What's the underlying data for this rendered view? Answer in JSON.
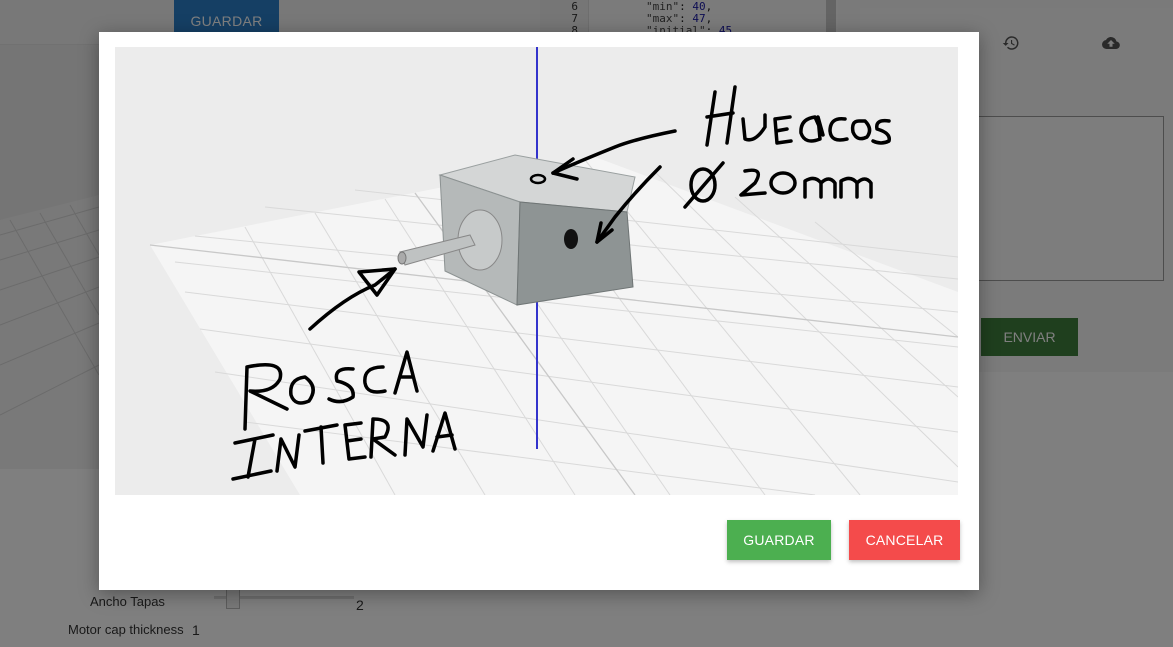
{
  "toolbar": {
    "save_label": "GUARDAR"
  },
  "editor": {
    "lines": [
      {
        "number": "6",
        "key": "\"min\"",
        "value": "40"
      },
      {
        "number": "7",
        "key": "\"max\"",
        "value": "47"
      },
      {
        "number": "8",
        "key": "\"initial\"",
        "value": "45"
      }
    ]
  },
  "side_panel": {
    "history_icon": "history-icon",
    "upload_icon": "cloud-upload-icon",
    "send_label": "ENVIAR"
  },
  "params": [
    {
      "label": "Ancho Tapas",
      "value": "2",
      "slider_fraction": 0.1
    },
    {
      "label": "Motor cap thickness",
      "value": "1"
    }
  ],
  "modal": {
    "save_label": "GUARDAR",
    "cancel_label": "CANCELAR",
    "sketch_annotations": {
      "holes": "HUECOS",
      "diameter": "Ø 20mm",
      "thread_line1": "ROSCA",
      "thread_line2": "INTERNA"
    }
  },
  "colors": {
    "primary_blue": "#2a7fc9",
    "save_green": "#4caf50",
    "cancel_red": "#f44b4b",
    "send_green": "#3f7f3d",
    "axis_blue": "#3333cc"
  }
}
